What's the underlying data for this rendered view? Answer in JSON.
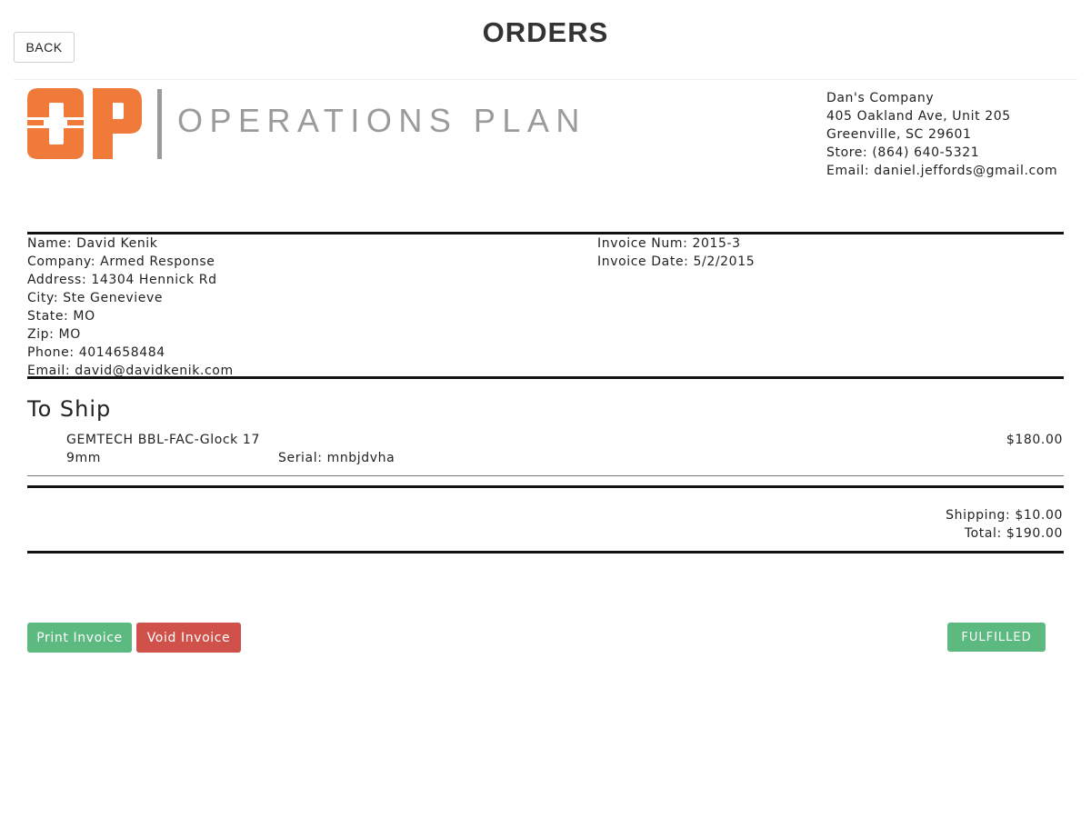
{
  "header": {
    "back_label": "BACK",
    "title": "ORDERS"
  },
  "logo": {
    "mark": "OP",
    "text": "OPERATIONS PLAN",
    "mark_color": "#f07a3a",
    "text_color": "#9b9b9b"
  },
  "company": {
    "name": "Dan's Company",
    "address": "405 Oakland Ave, Unit 205",
    "city_state_zip": "Greenville, SC 29601",
    "store_phone": "Store: (864) 640-5321",
    "email": "Email: daniel.jeffords@gmail.com"
  },
  "customer": {
    "name": "Name: David Kenik",
    "company": "Company: Armed Response",
    "address": "Address: 14304 Hennick Rd",
    "city": "City: Ste Genevieve",
    "state": "State: MO",
    "zip": "Zip: MO",
    "phone": "Phone: 4014658484",
    "email": "Email: david@davidkenik.com"
  },
  "invoice": {
    "number": "Invoice Num: 2015-3",
    "date": "Invoice Date: 5/2/2015"
  },
  "to_ship": {
    "heading": "To Ship",
    "items": [
      {
        "name": "GEMTECH BBL-FAC-Glock 17",
        "caliber": "9mm",
        "serial": "Serial: mnbjdvha",
        "price": "$180.00"
      }
    ]
  },
  "totals": {
    "shipping": "Shipping: $10.00",
    "total": "Total: $190.00"
  },
  "actions": {
    "print_label": "Print Invoice",
    "void_label": "Void Invoice",
    "status_label": "FULFILLED",
    "print_color": "#5cb97f",
    "void_color": "#d0504a",
    "status_color": "#5cb97f"
  }
}
